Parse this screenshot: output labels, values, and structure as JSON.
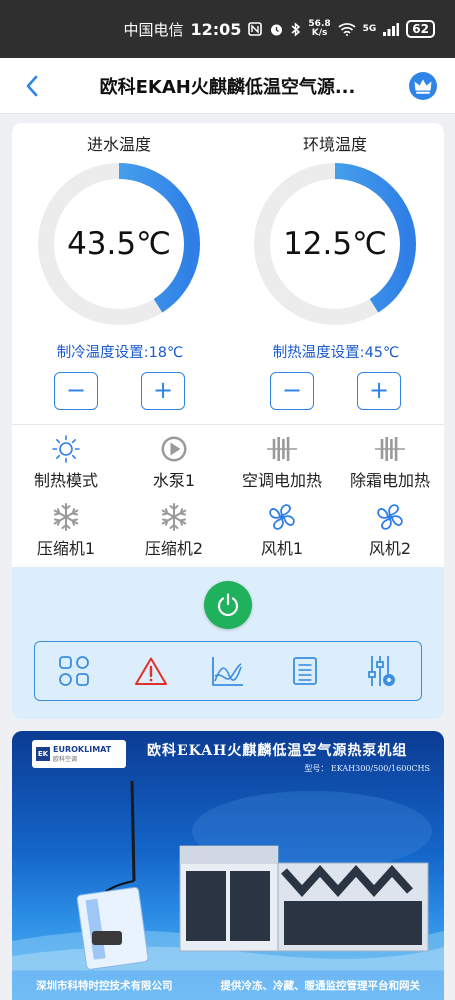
{
  "status_bar": {
    "carrier": "中国电信",
    "time": "12:05",
    "net_speed_value": "56.8",
    "net_speed_unit": "K/s",
    "signal_type": "5G",
    "battery": "62"
  },
  "header": {
    "title": "欧科EKAH火麒麟低温空气源...",
    "back_icon": "chevron-left-icon",
    "crown_icon": "crown-icon"
  },
  "gauges": [
    {
      "label": "进水温度",
      "value": "43.5℃",
      "fill_fraction": 0.41
    },
    {
      "label": "环境温度",
      "value": "12.5℃",
      "fill_fraction": 0.41
    }
  ],
  "setpoints": {
    "cooling": "制冷温度设置:18℃",
    "heating": "制热温度设置:45℃",
    "minus": "−",
    "plus": "+"
  },
  "status_items": [
    {
      "label": "制热模式",
      "icon": "sun-icon",
      "color": "#2f7fe6"
    },
    {
      "label": "水泵1",
      "icon": "pump-icon",
      "color": "#9a9a9a"
    },
    {
      "label": "空调电加热",
      "icon": "heater-icon",
      "color": "#9a9a9a"
    },
    {
      "label": "除霜电加热",
      "icon": "heater-icon",
      "color": "#9a9a9a"
    },
    {
      "label": "压缩机1",
      "icon": "snowflake-icon",
      "color": "#9a9a9a"
    },
    {
      "label": "压缩机2",
      "icon": "snowflake-icon",
      "color": "#9a9a9a"
    },
    {
      "label": "风机1",
      "icon": "fan-icon",
      "color": "#2f7fe6"
    },
    {
      "label": "风机2",
      "icon": "fan-icon",
      "color": "#2f7fe6"
    }
  ],
  "toolbar": {
    "power_icon": "power-icon",
    "items": [
      "grid-icon",
      "alarm-icon",
      "chart-icon",
      "list-icon",
      "settings-icon"
    ]
  },
  "banner": {
    "logo_mark": "EK",
    "logo_brand": "EUROKLIMAT",
    "logo_sub": "欧科空调",
    "title": "欧科EKAH火麒麟低温空气源热泵机组",
    "model": "型号：  EKAH300/500/1600CHS",
    "footer_left": "深圳市科特时控技术有限公司",
    "footer_right": "提供冷冻、冷藏、暖通监控管理平台和网关"
  },
  "colors": {
    "accent": "#2f84e8",
    "setpoint_text": "#1a5bd1",
    "power": "#1fb15b",
    "alarm": "#e0302a",
    "control_bg": "#dcedfb"
  }
}
